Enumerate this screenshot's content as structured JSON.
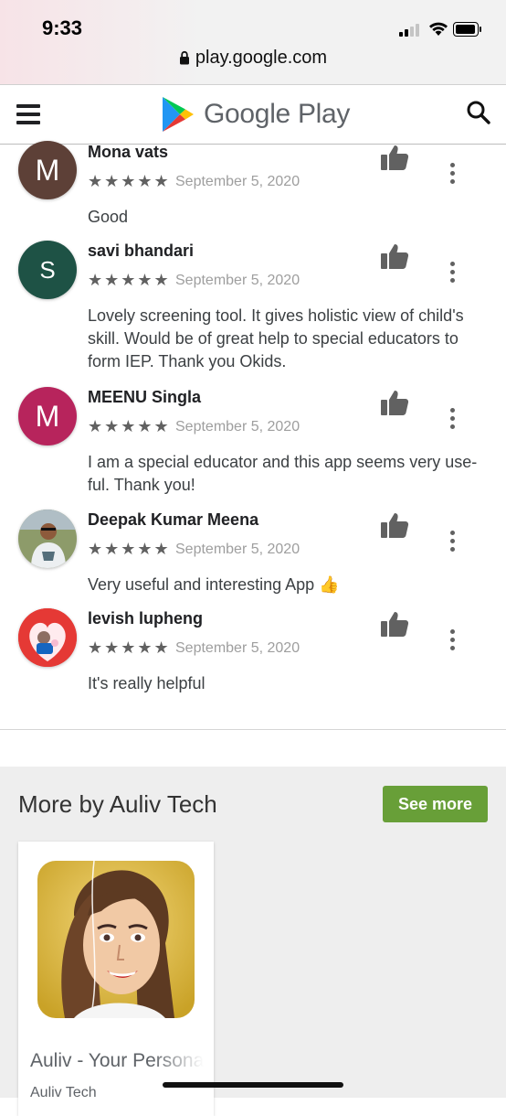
{
  "status_bar": {
    "time": "9:33"
  },
  "browser": {
    "url": "play.google.com"
  },
  "header": {
    "brand": "Google Play"
  },
  "reviews": [
    {
      "name": "Mona vats",
      "initial": "M",
      "avatar_color": "#5d4037",
      "stars": "★★★★★",
      "rating": 5,
      "date": "September 5, 2020",
      "text": "Good"
    },
    {
      "name": "savi bhandari",
      "initial": "S",
      "avatar_color": "#1e5245",
      "stars": "★★★★★",
      "rating": 5,
      "date": "September 5, 2020",
      "text": "Lovely screening tool. It gives holistic view of child's skill. Would be of great help to special educators to form IEP. Thank you Okids."
    },
    {
      "name": "MEENU Singla",
      "initial": "M",
      "avatar_color": "#b7245c",
      "stars": "★★★★★",
      "rating": 5,
      "date": "September 5, 2020",
      "text": "I am a special educator and this app seems very use-ful. Thank you!"
    },
    {
      "name": "Deepak Kumar Meena",
      "initial": "",
      "avatar_color": "#8d6e63",
      "stars": "★★★★★",
      "rating": 5,
      "date": "September 5, 2020",
      "text": "Very useful and interesting App 👍"
    },
    {
      "name": "levish lupheng",
      "initial": "",
      "avatar_color": "#e53935",
      "stars": "★★★★★",
      "rating": 5,
      "date": "September 5, 2020",
      "text": "It's really helpful"
    }
  ],
  "more_by": {
    "title": "More by Auliv Tech",
    "see_more_label": "See more",
    "apps": [
      {
        "name": "Auliv - Your Personal",
        "developer": "Auliv Tech"
      }
    ]
  },
  "colors": {
    "accent_green": "#689f38",
    "icon_gray": "#616161"
  }
}
